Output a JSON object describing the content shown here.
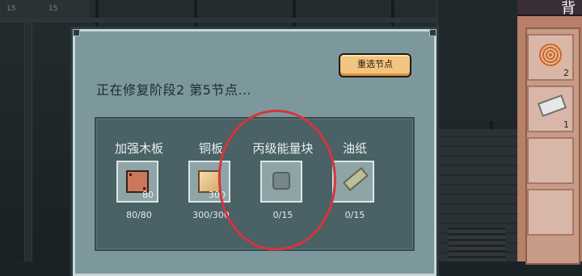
{
  "hud": {
    "values": [
      "15",
      "15"
    ]
  },
  "modal": {
    "reselect_label": "重选节点",
    "status": "正在修复阶段2 第5节点..."
  },
  "materials": [
    {
      "name": "加强木板",
      "icon": "reinforced-plank-icon",
      "slot_count": "80",
      "progress": "80/80"
    },
    {
      "name": "铜板",
      "icon": "copper-plate-icon",
      "slot_count": "300",
      "progress": "300/300"
    },
    {
      "name": "丙级能量块",
      "icon": "energy-block-icon",
      "slot_count": "",
      "progress": "0/15"
    },
    {
      "name": "油纸",
      "icon": "oil-paper-icon",
      "slot_count": "",
      "progress": "0/15"
    }
  ],
  "inventory": {
    "header_glyph": "背",
    "slots": [
      {
        "icon": "copper-coil-icon",
        "count": "2"
      },
      {
        "icon": "metal-scrap-icon",
        "count": "1"
      },
      {
        "icon": "",
        "count": ""
      },
      {
        "icon": "",
        "count": ""
      }
    ]
  },
  "colors": {
    "highlight_circle": "#d9343c",
    "button": "#f2c480",
    "modal_bg": "#7d989c"
  }
}
